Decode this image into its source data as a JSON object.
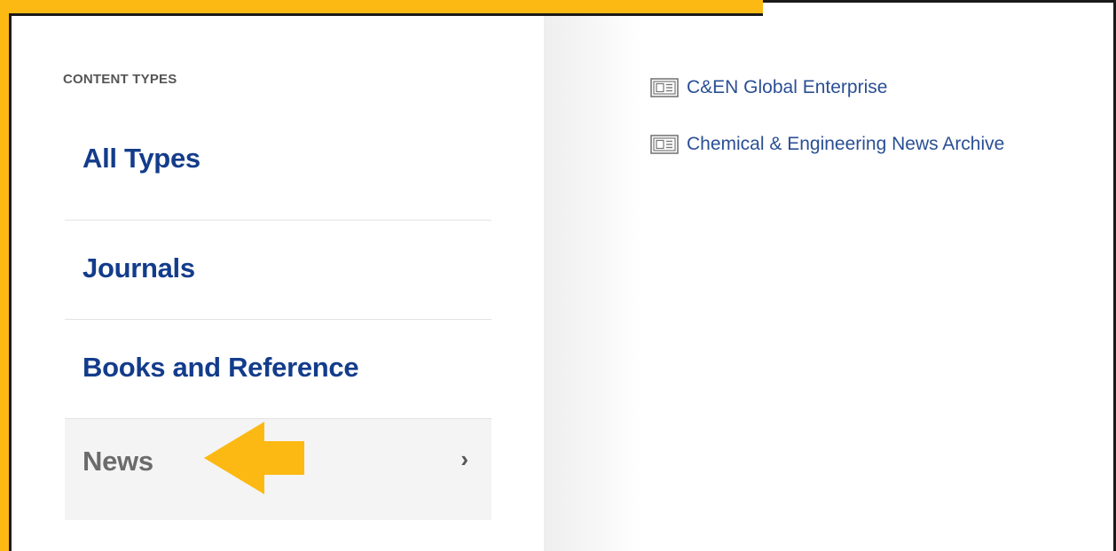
{
  "content_types": {
    "heading": "CONTENT TYPES",
    "items": [
      {
        "label": "All Types"
      },
      {
        "label": "Journals"
      },
      {
        "label": "Books and Reference"
      },
      {
        "label": "News",
        "active": true,
        "chevron": "›"
      }
    ]
  },
  "news_links": [
    {
      "label": "C&EN Global Enterprise",
      "icon": "newspaper-icon"
    },
    {
      "label": "Chemical & Engineering News Archive",
      "icon": "newspaper-icon"
    }
  ],
  "colors": {
    "highlight": "#FDB913",
    "link_dark_blue": "#133c8b",
    "link_blue": "#2a4f94",
    "active_text": "#6b6b6b"
  }
}
